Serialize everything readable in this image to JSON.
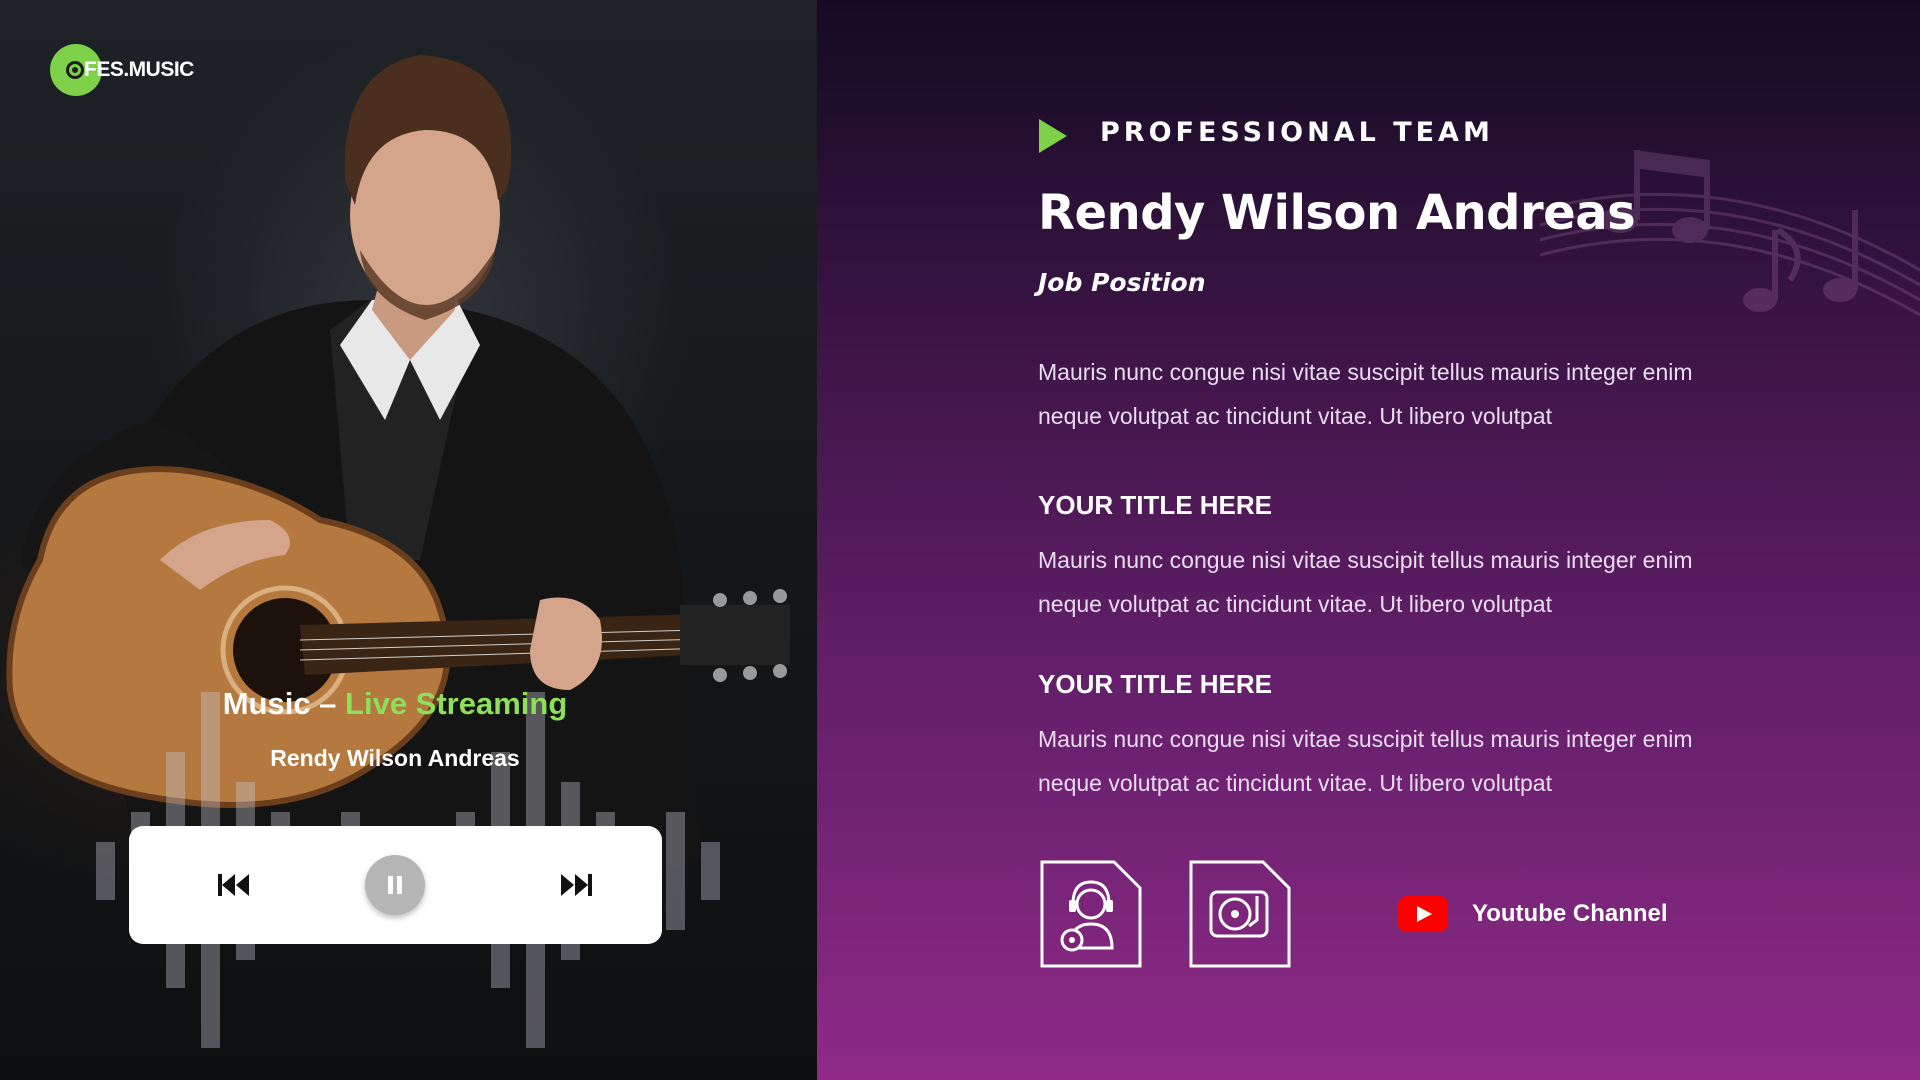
{
  "logo": {
    "text": "FES.MUSIC",
    "icon": "vinyl-record-icon",
    "color": "#7fd14a"
  },
  "player": {
    "title_prefix": "Music – ",
    "title_accent": "Live Streaming",
    "artist": "Rendy Wilson Andreas",
    "accent_color": "#8ee05a",
    "controls": {
      "prev_icon": "skip-previous-icon",
      "pause_icon": "pause-icon",
      "next_icon": "skip-next-icon"
    }
  },
  "profile": {
    "kicker": "PROFESSIONAL TEAM",
    "name": "Rendy Wilson Andreas",
    "position": "Job Position",
    "intro": "Mauris nunc congue nisi vitae suscipit tellus mauris integer enim neque volutpat ac tincidunt vitae. Ut libero volutpat",
    "sections": [
      {
        "title": "YOUR TITLE HERE",
        "text": "Mauris nunc congue nisi vitae suscipit tellus mauris integer enim neque volutpat ac tincidunt vitae. Ut libero volutpat"
      },
      {
        "title": "YOUR TITLE HERE",
        "text": "Mauris nunc congue nisi vitae suscipit tellus mauris integer enim neque volutpat ac tincidunt vitae. Ut libero volutpat"
      }
    ],
    "accent_color": "#7fd14a"
  },
  "links": {
    "icons": [
      "dj-headset-document-icon",
      "turntable-document-icon"
    ],
    "youtube_label": "Youtube Channel",
    "youtube_color": "#ff0000"
  }
}
